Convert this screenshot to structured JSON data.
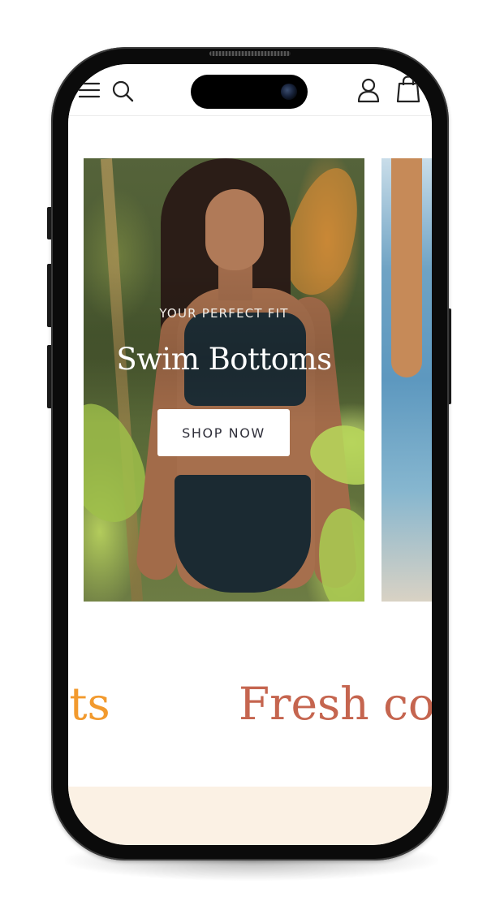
{
  "header": {
    "icons": [
      "menu-icon",
      "search-icon",
      "account-icon",
      "bag-icon"
    ]
  },
  "hero": {
    "eyebrow": "YOUR PERFECT FIT",
    "title": "Swim Bottoms",
    "cta_label": "SHOP NOW"
  },
  "marquee": {
    "items": [
      "nts",
      "Fresh co"
    ]
  },
  "colors": {
    "marquee_orange": "#f29a2e",
    "marquee_rust": "#c5654f",
    "cream_band": "#fbf1e4",
    "cta_text": "#2f2f3a"
  }
}
